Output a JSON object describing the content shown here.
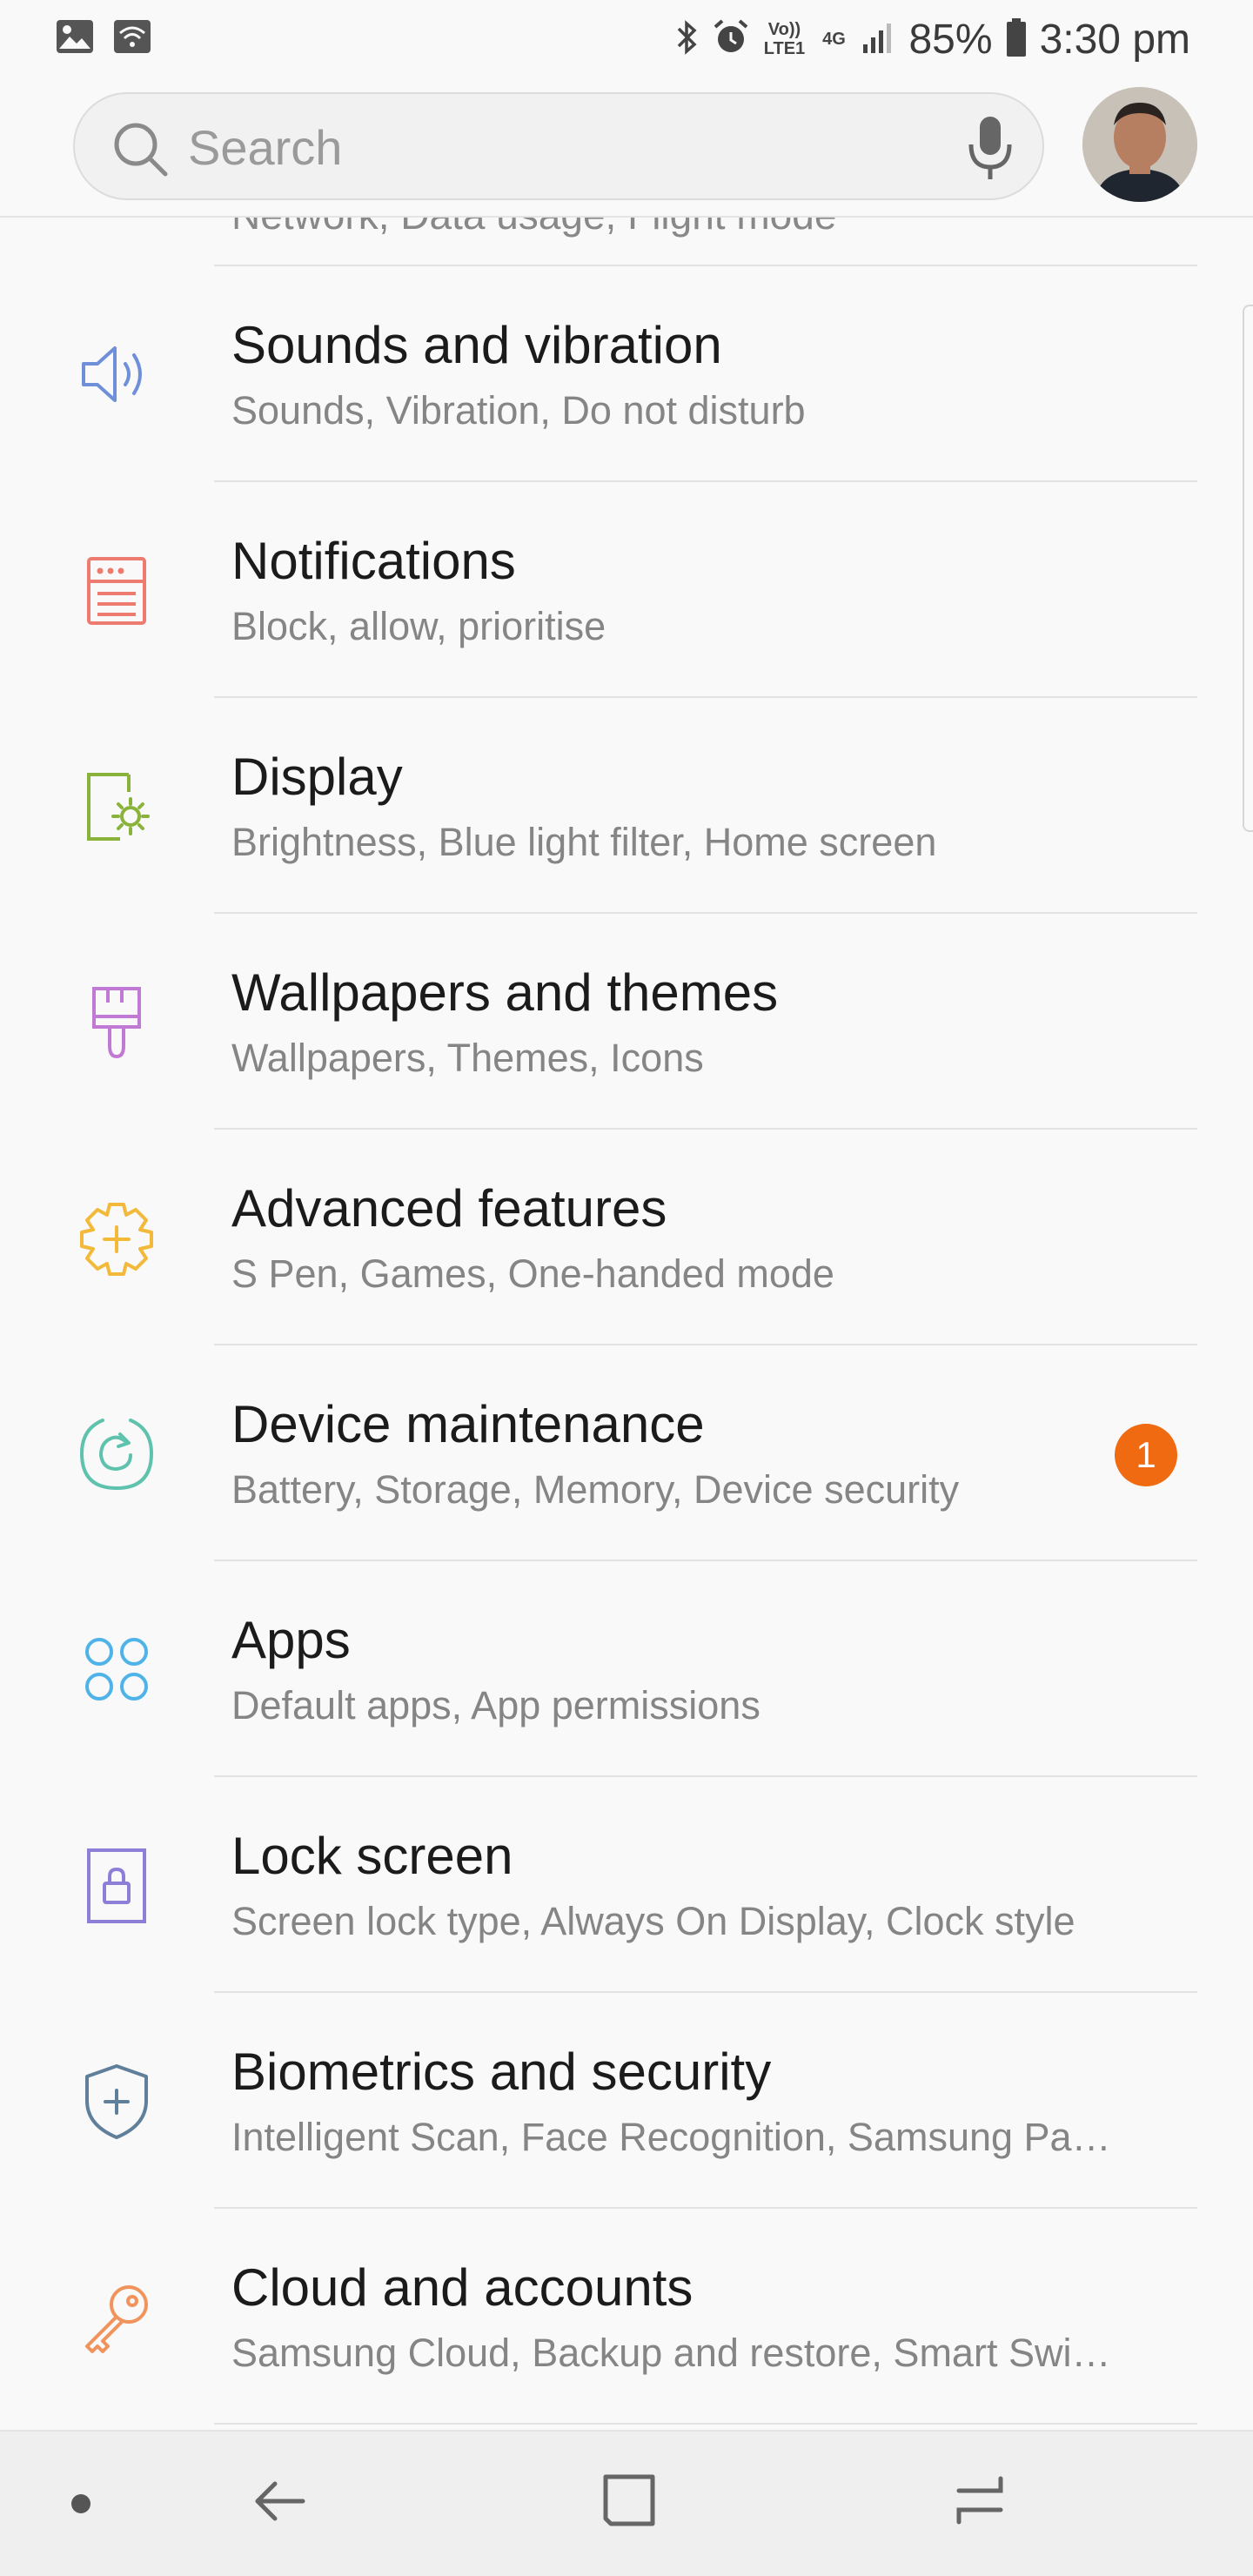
{
  "status_bar": {
    "battery": "85%",
    "time": "3:30 pm",
    "volte": "Vo)) LTE1",
    "network": "4G"
  },
  "search": {
    "placeholder": "Search"
  },
  "settings": {
    "cut_off_subtitle": "Network, Data usage, Flight mode",
    "items": [
      {
        "title": "Sounds and vibration",
        "subtitle": "Sounds, Vibration, Do not disturb",
        "icon": "speaker-icon",
        "color": "#6f8fd8"
      },
      {
        "title": "Notifications",
        "subtitle": "Block, allow, prioritise",
        "icon": "notifications-icon",
        "color": "#ee7b6f"
      },
      {
        "title": "Display",
        "subtitle": "Brightness, Blue light filter, Home screen",
        "icon": "display-brightness-icon",
        "color": "#8ab33b"
      },
      {
        "title": "Wallpapers and themes",
        "subtitle": "Wallpapers, Themes, Icons",
        "icon": "paintbrush-icon",
        "color": "#c17ad3"
      },
      {
        "title": "Advanced features",
        "subtitle": "S Pen, Games, One-handed mode",
        "icon": "gear-plus-icon",
        "color": "#f2b93b"
      },
      {
        "title": "Device maintenance",
        "subtitle": "Battery, Storage, Memory, Device security",
        "icon": "refresh-circle-icon",
        "color": "#5fc2ad",
        "badge": "1"
      },
      {
        "title": "Apps",
        "subtitle": "Default apps, App permissions",
        "icon": "apps-grid-icon",
        "color": "#4fb3e8"
      },
      {
        "title": "Lock screen",
        "subtitle": "Screen lock type, Always On Display, Clock style",
        "icon": "lock-icon",
        "color": "#8d7fd8"
      },
      {
        "title": "Biometrics and security",
        "subtitle": "Intelligent Scan, Face Recognition, Samsung Pa…",
        "icon": "shield-plus-icon",
        "color": "#5f7f9b"
      },
      {
        "title": "Cloud and accounts",
        "subtitle": "Samsung Cloud, Backup and restore, Smart Swi…",
        "icon": "key-icon",
        "color": "#f0935c"
      }
    ]
  },
  "colors": {
    "badge": "#f06a12",
    "background": "#f9f9f9"
  }
}
